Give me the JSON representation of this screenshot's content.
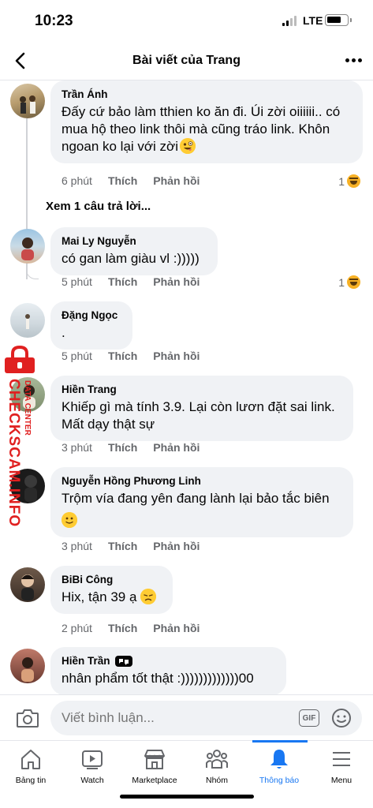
{
  "status_bar": {
    "time": "10:23",
    "network": "LTE"
  },
  "header": {
    "title": "Bài viết của Trang"
  },
  "comments": [
    {
      "author": "Trần Ánh",
      "text": "Đấy cứ bảo làm tthien ko ăn đi. Úi zời oiiiiii.. có mua hộ theo link thôi mà cũng tráo link. Khôn ngoan ko lại với zời",
      "emoji": "zany-face",
      "time": "6 phút",
      "like": "Thích",
      "reply": "Phản hồi",
      "reaction_count": "1",
      "reaction": "haha"
    },
    {
      "author": "Mai Ly Nguyễn",
      "text": "có gan làm giàu vl :)))))",
      "time": "5 phút",
      "like": "Thích",
      "reply": "Phản hồi",
      "reaction_count": "1",
      "reaction": "haha"
    },
    {
      "author": "Đặng Ngọc",
      "text": ".",
      "time": "5 phút",
      "like": "Thích",
      "reply": "Phản hồi"
    },
    {
      "author": "Hiền Trang",
      "text": "Khiếp gì mà tính 3.9. Lại còn lươn đặt sai link. Mất dạy thật sự",
      "time": "3 phút",
      "like": "Thích",
      "reply": "Phản hồi"
    },
    {
      "author": "Nguyễn Hồng Phương Linh",
      "text": "Trộm vía đang yên đang lành lại bảo tắc biên",
      "emoji": "slightly-smiling-face",
      "time": "3 phút",
      "like": "Thích",
      "reply": "Phản hồi"
    },
    {
      "author": "BiBi Công",
      "text": "Hix, tận 39 ạ",
      "emoji": "disappointed-face",
      "time": "2 phút",
      "like": "Thích",
      "reply": "Phản hồi"
    },
    {
      "author": "Hiền Trần",
      "text": "nhân phẩm tốt thật :)))))))))))))00",
      "badge": "fan-badge-icon"
    }
  ],
  "view_replies": "Xem 1 câu trả lời...",
  "watermark": {
    "brand": "CHECKSCAM.INFO",
    "sub": "DATA CENTER"
  },
  "composer": {
    "placeholder": "Viết bình luận...",
    "gif": "GIF"
  },
  "tabbar": [
    {
      "label": "Bảng tin",
      "icon": "home-icon"
    },
    {
      "label": "Watch",
      "icon": "watch-icon"
    },
    {
      "label": "Marketplace",
      "icon": "marketplace-icon"
    },
    {
      "label": "Nhóm",
      "icon": "groups-icon"
    },
    {
      "label": "Thông báo",
      "icon": "bell-icon",
      "active": true
    },
    {
      "label": "Menu",
      "icon": "menu-icon"
    }
  ],
  "colors": {
    "accent": "#1877f2",
    "bubble": "#f0f2f5",
    "muted": "#65676b",
    "watermark": "#e02020"
  }
}
